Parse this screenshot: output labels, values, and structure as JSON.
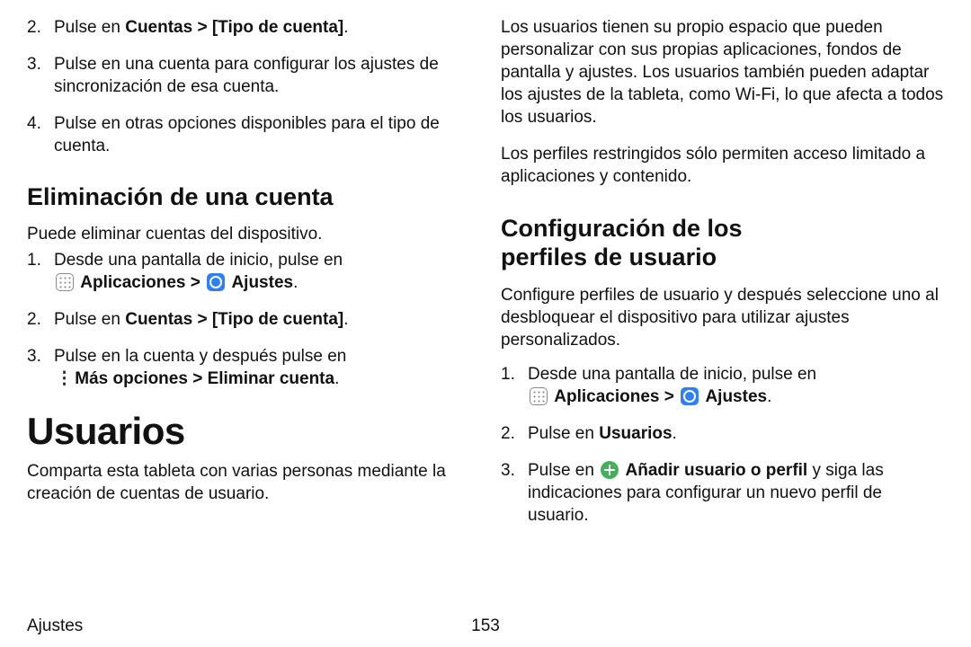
{
  "footer": {
    "section": "Ajustes",
    "page_number": "153"
  },
  "left": {
    "intro_list": [
      {
        "num": "2.",
        "pre": "Pulse en ",
        "bold": "Cuentas > [Tipo de cuenta]",
        "post": "."
      },
      {
        "num": "3.",
        "text": "Pulse en una cuenta para configurar los ajustes de sincronización de esa cuenta."
      },
      {
        "num": "4.",
        "text": "Pulse en otras opciones disponibles para el tipo de cuenta."
      }
    ],
    "h2_remove": "Eliminación de una cuenta",
    "remove_intro": "Puede eliminar cuentas del dispositivo.",
    "remove_list": {
      "item1": {
        "num": "1.",
        "pre": "Desde una pantalla de inicio, pulse en ",
        "apps_label": "Aplicaciones",
        "sep": " > ",
        "ajustes_label": "Ajustes",
        "post": "."
      },
      "item2": {
        "num": "2.",
        "pre": "Pulse en ",
        "bold": "Cuentas > [Tipo de cuenta]",
        "post": "."
      },
      "item3": {
        "num": "3.",
        "pre": "Pulse en la cuenta y después pulse en ",
        "bold": "Más opciones > Eliminar cuenta",
        "post": "."
      }
    },
    "h1_users": "Usuarios",
    "users_intro": "Comparta esta tableta con varias personas mediante la creación de cuentas de usuario."
  },
  "right": {
    "body_p1": "Los usuarios tienen su propio espacio que pueden personalizar con sus propias aplicaciones, fondos de pantalla y ajustes. Los usuarios también pueden adaptar los ajustes de la tableta, como Wi-Fi, lo que afecta a todos los usuarios.",
    "body_p2": "Los perfiles restringidos sólo permiten acceso limitado a aplicaciones y contenido.",
    "h2_profiles_l1": "Configuración de los",
    "h2_profiles_l2": "perfiles de usuario",
    "profiles_intro": "Configure perfiles de usuario y después seleccione uno al desbloquear el dispositivo para utilizar ajustes personalizados.",
    "profiles_list": {
      "item1": {
        "num": "1.",
        "pre": "Desde una pantalla de inicio, pulse en ",
        "apps_label": "Aplicaciones",
        "sep": " > ",
        "ajustes_label": "Ajustes",
        "post": "."
      },
      "item2": {
        "num": "2.",
        "pre": "Pulse en ",
        "bold": "Usuarios",
        "post": "."
      },
      "item3": {
        "num": "3.",
        "pre": "Pulse en ",
        "bold": "Añadir usuario o perfil",
        "post": " y siga las indicaciones para configurar un nuevo perfil de usuario."
      }
    }
  }
}
